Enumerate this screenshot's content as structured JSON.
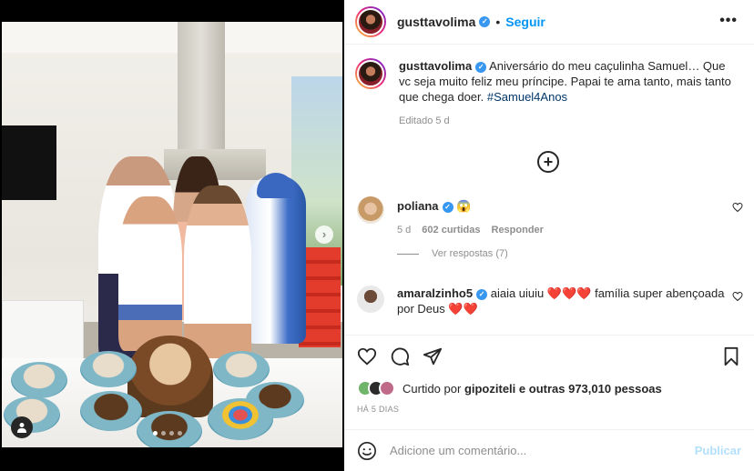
{
  "post": {
    "username": "gusttavolima",
    "follow_label": "Seguir",
    "separator": "•",
    "more_label": "•••"
  },
  "caption": {
    "username": "gusttavolima",
    "text": "Aniversário do meu caçulinha Samuel… Que vc seja muito feliz meu príncipe. Papai te ama tanto, mais tanto que chega doer.",
    "hashtag": "#Samuel4Anos",
    "edited_label": "Editado",
    "age": "5 d"
  },
  "comments": [
    {
      "username": "poliana",
      "text": "😱",
      "age": "5 d",
      "likes": "602 curtidas",
      "reply_label": "Responder",
      "view_replies": "Ver respostas (7)"
    },
    {
      "username": "amaralzinho5",
      "text_part1": "aiaia uiuiu",
      "text_part2": "família super abençoada por Deus",
      "hearts_a": "❤️❤️❤️",
      "hearts_b": "❤️❤️"
    }
  ],
  "likes": {
    "prefix": "Curtido por",
    "user": "gipoziteli",
    "suffix": "e outras 973,010 pessoas"
  },
  "date_label": "HÁ 5 DIAS",
  "add_comment": {
    "placeholder": "Adicione um comentário...",
    "post_label": "Publicar"
  },
  "carousel": {
    "next_glyph": "›",
    "total_slides": 4,
    "active_index": 0
  },
  "icons": {
    "verified": "verified-badge-icon",
    "like": "heart-icon",
    "comment": "comment-icon",
    "share": "paper-plane-icon",
    "save": "bookmark-icon",
    "emoji": "smiley-icon",
    "load_more": "plus-circle-icon",
    "user_tag": "person-icon"
  },
  "colors": {
    "accent": "#0095f6",
    "verified": "#3897f0",
    "hashtag": "#00376b",
    "muted": "#8e8e8e",
    "post_disabled": "#b2dffc"
  }
}
